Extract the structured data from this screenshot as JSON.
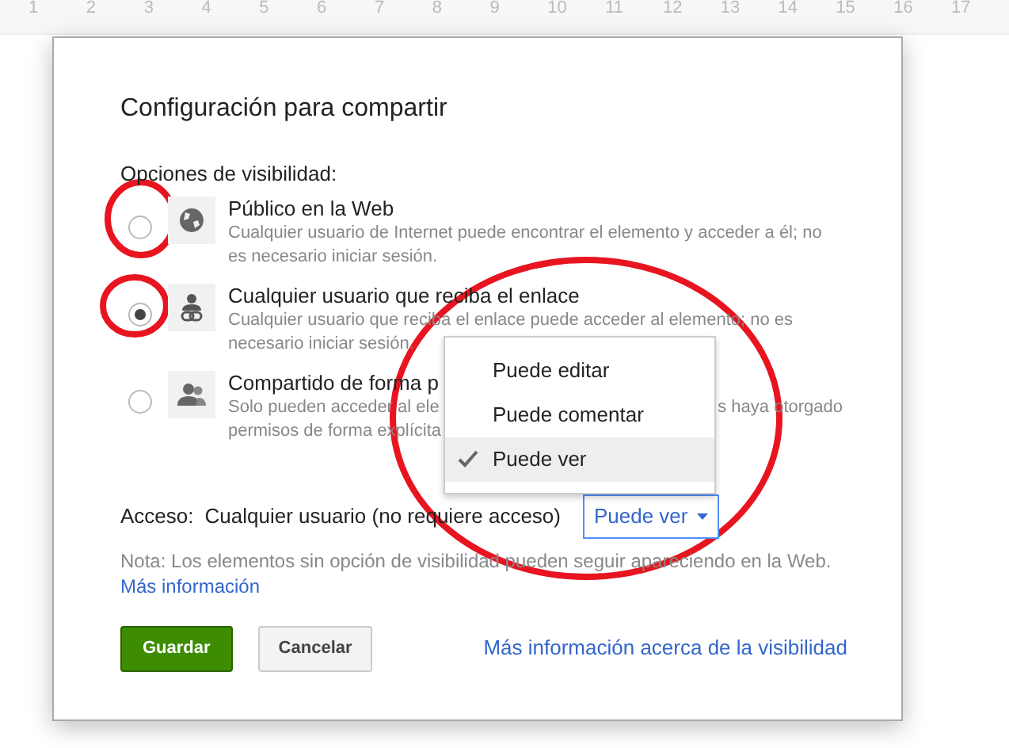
{
  "ruler": {
    "labels": [
      "1",
      "2",
      "3",
      "4",
      "5",
      "6",
      "7",
      "8",
      "9",
      "10",
      "11",
      "12",
      "13",
      "14",
      "15",
      "16",
      "17"
    ]
  },
  "dialog": {
    "title": "Configuración para compartir",
    "section_label": "Opciones de visibilidad:",
    "options": [
      {
        "kind": "globe",
        "selected": false,
        "title": "Público en la Web",
        "description": [
          "Cualquier usuario de Internet puede encontrar el elemento y acceder a él; no es necesario iniciar sesión."
        ]
      },
      {
        "kind": "link",
        "selected": true,
        "title": "Cualquier usuario que reciba el enlace",
        "description": [
          "Cualquier usuario que reciba el enlace puede acceder al elemento; no es necesario iniciar sesión."
        ]
      },
      {
        "kind": "people",
        "selected": false,
        "title": "Compartido de forma p",
        "description": [
          "Solo pueden acceder al ele",
          "s haya otorgado",
          "permisos de forma explícita"
        ]
      }
    ],
    "access": {
      "label": "Acceso:",
      "value": "Cualquier usuario (no requiere acceso)",
      "dropdown": "Puede ver"
    },
    "menu": [
      {
        "label": "Puede editar",
        "selected": false
      },
      {
        "label": "Puede comentar",
        "selected": false
      },
      {
        "label": "Puede ver",
        "selected": true
      }
    ],
    "note": {
      "text": "Nota: Los elementos sin opción de visibilidad pueden seguir apareciendo en la Web.",
      "link": "Más información"
    },
    "buttons": [
      {
        "label": "Guardar",
        "kind": "primary"
      },
      {
        "label": "Cancelar",
        "kind": "secondary"
      }
    ],
    "footer_link": "Más información acerca de la visibilidad"
  }
}
